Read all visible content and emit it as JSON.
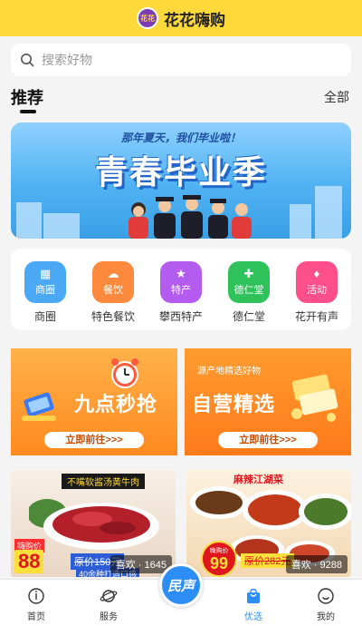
{
  "header": {
    "title": "花花嗨购",
    "logo_text": "花花"
  },
  "search": {
    "placeholder": "搜索好物",
    "value": ""
  },
  "recommend": {
    "title": "推荐",
    "more_label": "全部"
  },
  "banner": {
    "subtitle": "那年夏天，我们毕业啦！",
    "title": "青春毕业季"
  },
  "quick_menu": [
    {
      "icon": "shop-icon",
      "icon_text": "商圈",
      "label": "商圈",
      "color": "#4aa8f5"
    },
    {
      "icon": "chef-hat-icon",
      "icon_text": "餐饮",
      "label": "特色餐饮",
      "color": "#ff8a3d"
    },
    {
      "icon": "star-bag-icon",
      "icon_text": "特产",
      "label": "攀西特产",
      "color": "#b45cf0"
    },
    {
      "icon": "medicine-box-icon",
      "icon_text": "德仁堂",
      "label": "德仁堂",
      "color": "#2fc25b"
    },
    {
      "icon": "running-icon",
      "icon_text": "活动",
      "label": "花开有声",
      "color": "#ff4f8b"
    }
  ],
  "promos": [
    {
      "title": "九点秒抢",
      "button": "立即前往>>>",
      "subtitle": ""
    },
    {
      "title": "自营精选",
      "button": "立即前往>>>",
      "subtitle": "源产地精选好物"
    }
  ],
  "products": [
    {
      "banner_text": "不嘴软酱汤黄牛肉",
      "badge": "嗨购价",
      "price": "88",
      "orig_price": "原价150元",
      "note": "40余种打造口感",
      "likes": "喜欢 · 1645"
    },
    {
      "banner_text": "麻辣江湖菜",
      "badge": "嗨购价",
      "price": "99",
      "orig_price": "原价282元",
      "likes": "喜欢 · 9288"
    }
  ],
  "tabbar": {
    "items": [
      {
        "label": "首页",
        "icon": "home-icon"
      },
      {
        "label": "服务",
        "icon": "planet-icon"
      },
      {
        "label": "优选",
        "icon": "shopping-bag-icon",
        "active": true
      },
      {
        "label": "我的",
        "icon": "smile-icon"
      }
    ],
    "center_label": "民声"
  },
  "colors": {
    "header": "#ffd93a",
    "accent": "#2c8ef5"
  }
}
